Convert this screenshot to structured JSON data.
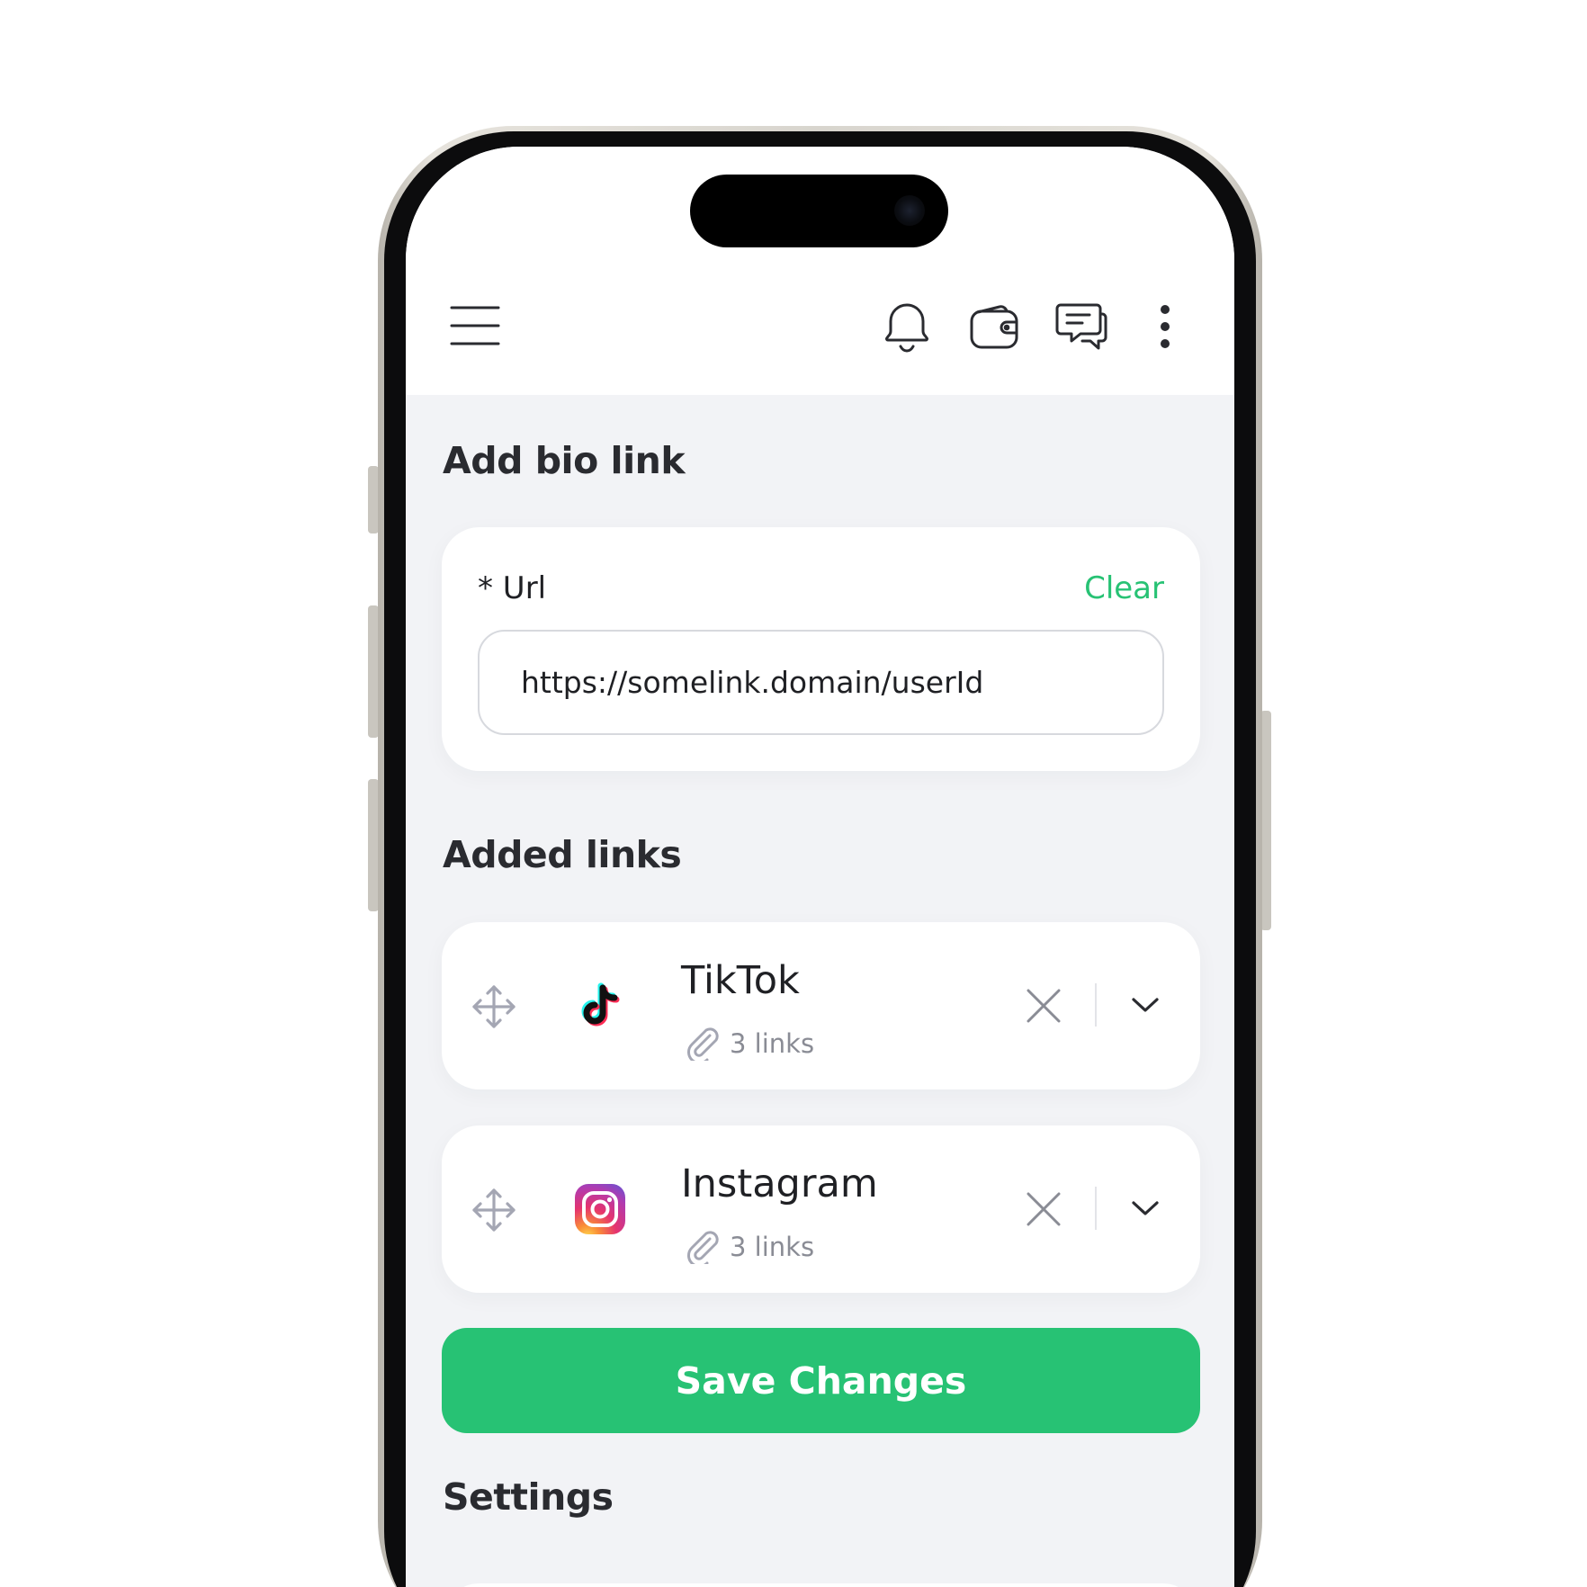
{
  "toolbar": {
    "menu_icon": "hamburger-menu-icon",
    "notifications_icon": "bell-icon",
    "wallet_icon": "wallet-icon",
    "messages_icon": "chat-bubbles-icon",
    "more_icon": "vertical-dots-icon"
  },
  "add_bio_link": {
    "title": "Add bio link",
    "url_label": "* Url",
    "clear_label": "Clear",
    "url_value": "https://somelink.domain/userId"
  },
  "added_links": {
    "title": "Added links",
    "items": [
      {
        "name": "TikTok",
        "count_label": "3 links",
        "icon": "tiktok-icon"
      },
      {
        "name": "Instagram",
        "count_label": "3 links",
        "icon": "instagram-icon"
      }
    ]
  },
  "save_button": {
    "label": "Save Changes"
  },
  "settings": {
    "title": "Settings"
  },
  "colors": {
    "accent": "#27c274",
    "background": "#f2f3f6",
    "card": "#ffffff",
    "muted_text": "#8a8c95",
    "icon_gray": "#a4a6b3"
  }
}
